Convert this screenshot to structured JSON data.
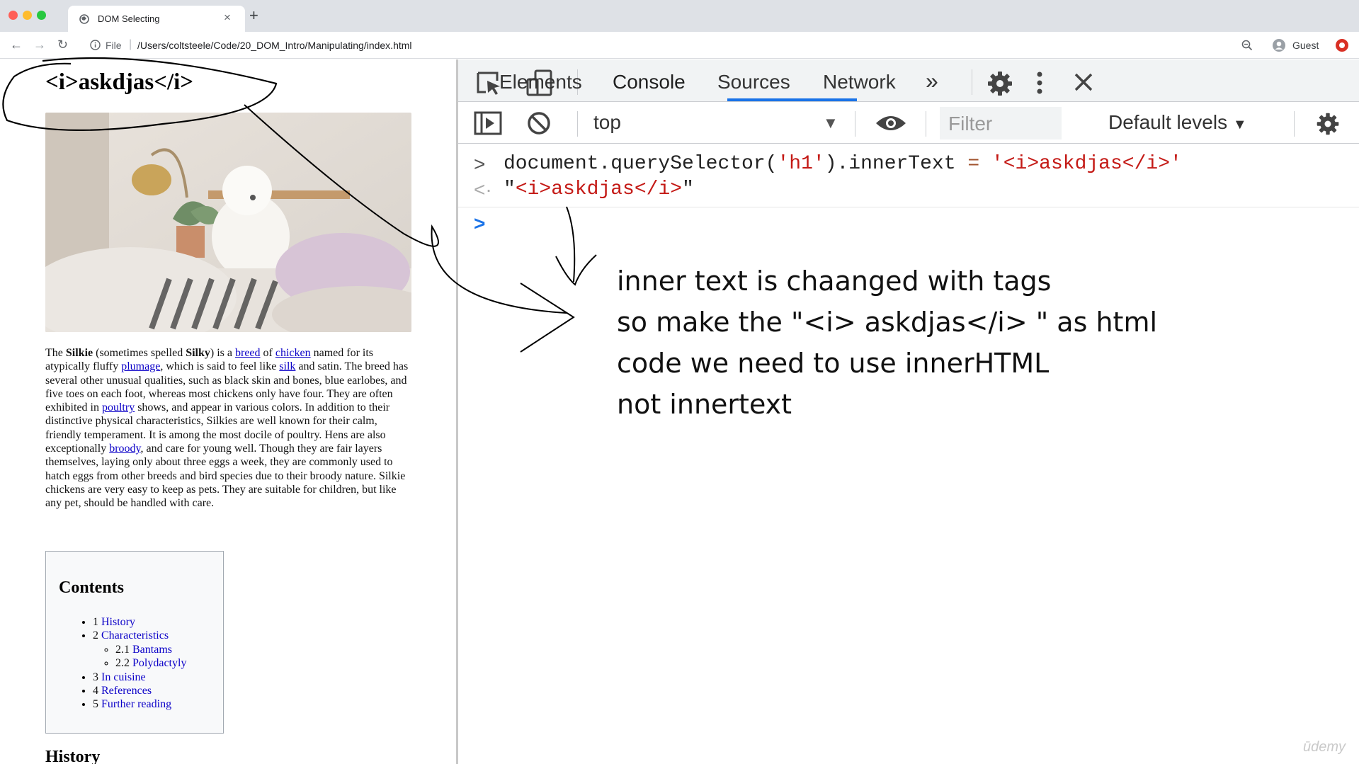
{
  "browser": {
    "tab_title": "DOM Selecting",
    "url_scheme_label": "File",
    "url_path": "/Users/coltsteele/Code/20_DOM_Intro/Manipulating/index.html",
    "profile_label": "Guest"
  },
  "page": {
    "heading": "<i>askdjas</i>",
    "paragraph": {
      "t1": "The ",
      "b1": "Silkie",
      "t2": " (sometimes spelled ",
      "b2": "Silky",
      "t3": ") is a ",
      "l1": "breed",
      "t4": " of ",
      "l2": "chicken",
      "t5": " named for its atypically fluffy ",
      "l3": "plumage",
      "t6": ", which is said to feel like ",
      "l4": "silk",
      "t7": " and satin. The breed has several other unusual qualities, such as black skin and bones, blue earlobes, and five toes on each foot, whereas most chickens only have four. They are often exhibited in ",
      "l5": "poultry",
      "t8": " shows, and appear in various colors. In addition to their distinctive physical characteristics, Silkies are well known for their calm, friendly temperament. It is among the most docile of poultry. Hens are also exceptionally ",
      "l6": "broody",
      "t9": ", and care for young well. Though they are fair layers themselves, laying only about three eggs a week, they are commonly used to hatch eggs from other breeds and bird species due to their broody nature. Silkie chickens are very easy to keep as pets. They are suitable for children, but like any pet, should be handled with care."
    },
    "toc": {
      "title": "Contents",
      "items": [
        {
          "num": "1",
          "label": "History"
        },
        {
          "num": "2",
          "label": "Characteristics"
        },
        {
          "num": "2.1",
          "label": "Bantams"
        },
        {
          "num": "2.2",
          "label": "Polydactyly"
        },
        {
          "num": "3",
          "label": "In cuisine"
        },
        {
          "num": "4",
          "label": "References"
        },
        {
          "num": "5",
          "label": "Further reading"
        }
      ]
    },
    "next_heading": "History"
  },
  "devtools": {
    "tabs": [
      "Elements",
      "Console",
      "Sources",
      "Network"
    ],
    "active_tab": "Console",
    "more_tabs_glyph": "»",
    "context": "top",
    "filter_placeholder": "Filter",
    "levels": "Default levels",
    "console": {
      "input_pre": "document.querySelector(",
      "input_sel": "'h1'",
      "input_mid": ").innerText ",
      "input_eq": "=",
      "input_val": "'<i>askdjas</i>'",
      "output_q1": "\"",
      "output_val": "<i>askdjas</i>",
      "output_q2": "\""
    }
  },
  "annotation": {
    "note": "inner text is chaanged with tags\nso make the \"<i> askdjas</i> \" as html\ncode we need to use innerHTML\nnot innertext"
  },
  "watermark": "ūdemy",
  "colors": {
    "link": "#0b00c8",
    "string": "#c41a16",
    "devtools_accent": "#1a73e8"
  }
}
